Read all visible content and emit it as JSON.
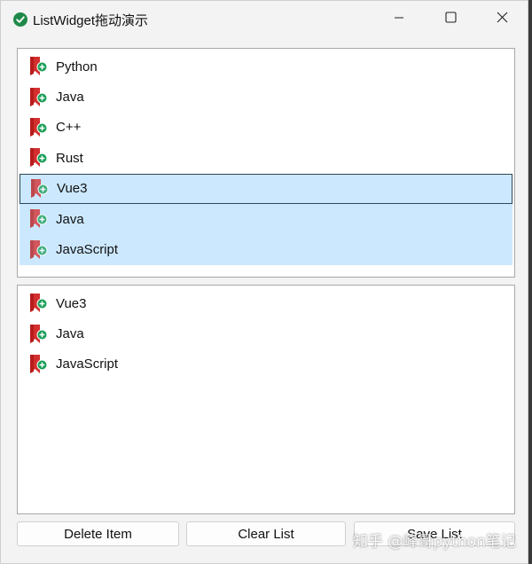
{
  "window": {
    "title": "ListWidget拖动演示"
  },
  "colors": {
    "selection": "#cce8ff",
    "accent_check": "#1e8a4a",
    "item_icon_red": "#d32f2f",
    "item_icon_badge": "#1a9e58"
  },
  "top_list": {
    "items": [
      {
        "label": "Python",
        "icon": "bookmark-add-icon",
        "selected": false
      },
      {
        "label": "Java",
        "icon": "bookmark-add-icon",
        "selected": false
      },
      {
        "label": "C++",
        "icon": "bookmark-add-icon",
        "selected": false
      },
      {
        "label": "Rust",
        "icon": "bookmark-add-icon",
        "selected": false
      },
      {
        "label": "Vue3",
        "icon": "bookmark-add-icon",
        "selected": true,
        "current": true
      },
      {
        "label": "Java",
        "icon": "bookmark-add-icon",
        "selected": true
      },
      {
        "label": "JavaScript",
        "icon": "bookmark-add-icon",
        "selected": true
      }
    ]
  },
  "bottom_list": {
    "items": [
      {
        "label": "Vue3",
        "icon": "bookmark-add-icon"
      },
      {
        "label": "Java",
        "icon": "bookmark-add-icon"
      },
      {
        "label": "JavaScript",
        "icon": "bookmark-add-icon"
      }
    ]
  },
  "buttons": {
    "delete": "Delete Item",
    "clear": "Clear List",
    "save": "Save List"
  },
  "watermark": "知乎 @峰哥python笔记"
}
